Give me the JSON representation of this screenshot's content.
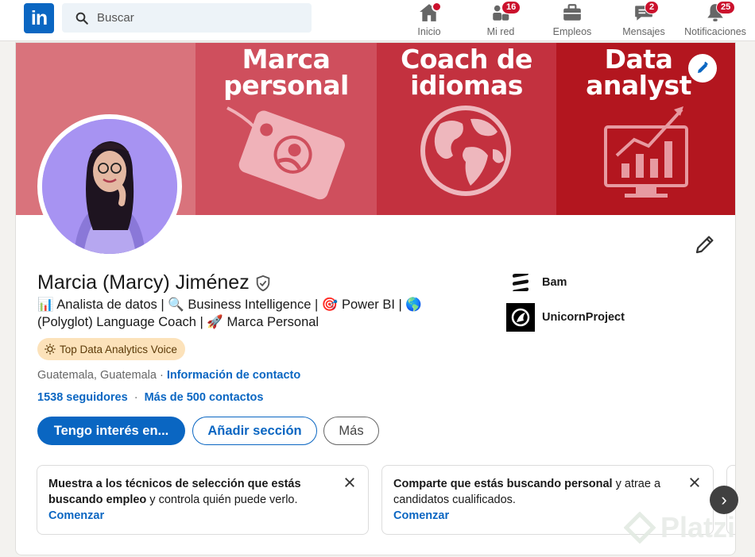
{
  "nav": {
    "logo_text": "in",
    "search_placeholder": "Buscar",
    "items": [
      {
        "label": "Inicio",
        "icon": "home-icon",
        "badge": ""
      },
      {
        "label": "Mi red",
        "icon": "network-icon",
        "badge": "16"
      },
      {
        "label": "Empleos",
        "icon": "briefcase-icon",
        "badge": ""
      },
      {
        "label": "Mensajes",
        "icon": "messaging-icon",
        "badge": "2"
      },
      {
        "label": "Notificaciones",
        "icon": "bell-icon",
        "badge": "25"
      }
    ]
  },
  "banner": {
    "panels": [
      {
        "title_line1": "",
        "title_line2": ""
      },
      {
        "title_line1": "Marca",
        "title_line2": "personal"
      },
      {
        "title_line1": "Coach de",
        "title_line2": "idiomas"
      },
      {
        "title_line1": "Data",
        "title_line2": "analyst"
      }
    ],
    "colors": [
      "#d9737c",
      "#cf4f5d",
      "#c3313f",
      "#b3161f"
    ]
  },
  "profile": {
    "name": "Marcia (Marcy) Jiménez",
    "headline_line1": "📊 Analista de datos | 🔍 Business Intelligence | 🎯 Power BI | 🌎",
    "headline_line2": "(Polyglot) Language Coach | 🚀 Marca Personal",
    "badge": "Top Data Analytics Voice",
    "location": "Guatemala, Guatemala",
    "location_sep": "·",
    "contact_info": "Información de contacto",
    "followers": "1538 seguidores",
    "stats_sep": "·",
    "connections": "Más de 500 contactos"
  },
  "buttons": {
    "primary": "Tengo interés en...",
    "secondary": "Añadir sección",
    "more": "Más"
  },
  "companies": [
    {
      "name": "Bam"
    },
    {
      "name": "UnicornProject"
    }
  ],
  "promos": [
    {
      "bold1": "Muestra a los técnicos de selección que estás buscando empleo",
      "rest": " y controla quién puede verlo.",
      "cta": "Comenzar"
    },
    {
      "bold1": "Comparte que estás buscando personal",
      "rest": " y atrae a candidatos cualificados.",
      "cta": "Comenzar"
    }
  ],
  "carousel_next": "›",
  "watermark": "Platzi",
  "accent": "#0a66c2"
}
